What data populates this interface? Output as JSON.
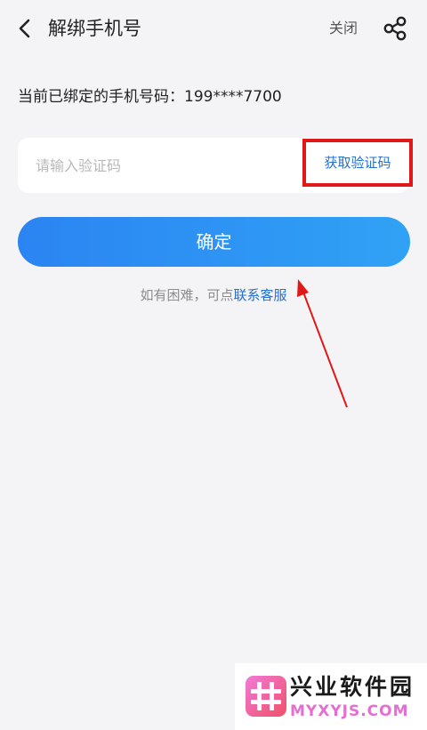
{
  "header": {
    "title": "解绑手机号",
    "close_label": "关闭",
    "back_icon": "chevron-left-icon",
    "share_icon": "share-icon"
  },
  "bound_phone": {
    "text": "当前已绑定的手机号码：199****7700"
  },
  "code_field": {
    "placeholder": "请输入验证码",
    "value": "",
    "get_code_label": "获取验证码"
  },
  "confirm": {
    "label": "确定"
  },
  "help": {
    "prefix": "如有困难，可点",
    "link": "联系客服"
  },
  "watermark": {
    "title": "兴业软件园",
    "url": "MYXYJS.COM"
  },
  "colors": {
    "background": "#f4f4f6",
    "accent": "#2170d8",
    "button_gradient_start": "#2b84f2",
    "button_gradient_end": "#30a2f5",
    "highlight_red": "#e01818",
    "watermark_pink": "#e46fd0"
  }
}
